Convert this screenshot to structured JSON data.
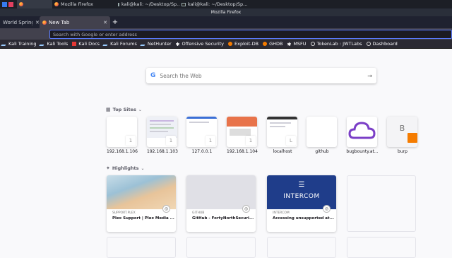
{
  "taskbar": {
    "items": [
      {
        "label": ""
      },
      {
        "label": "Mozilla Firefox"
      },
      {
        "label": "kali@kali: ~/Desktop/Sp..."
      },
      {
        "label": "kali@kali: ~/Desktop/Sp..."
      }
    ]
  },
  "window": {
    "title": "Mozilla Firefox"
  },
  "tabs": [
    {
      "label": "World Spring"
    },
    {
      "label": "New Tab"
    }
  ],
  "url_bar": {
    "placeholder": "Search with Google or enter address"
  },
  "bookmarks": [
    {
      "label": "Kali Training",
      "icon": "kali-icon"
    },
    {
      "label": "Kali Tools",
      "icon": "kali-icon"
    },
    {
      "label": "Kali Docs",
      "icon": "kali-docs-icon"
    },
    {
      "label": "Kali Forums",
      "icon": "kali-icon"
    },
    {
      "label": "NetHunter",
      "icon": "kali-icon"
    },
    {
      "label": "Offensive Security",
      "icon": "offsec-icon"
    },
    {
      "label": "Exploit-DB",
      "icon": "exploitdb-icon"
    },
    {
      "label": "GHDB",
      "icon": "exploitdb-icon"
    },
    {
      "label": "MSFU",
      "icon": "offsec-icon"
    },
    {
      "label": "TokenLab : JWTLabs",
      "icon": "globe-icon"
    },
    {
      "label": "Dashboard",
      "icon": "globe-icon"
    }
  ],
  "search": {
    "placeholder": "Search the Web"
  },
  "top_sites": {
    "title": "Top Sites",
    "items": [
      {
        "label": "192.168.1.106",
        "badge": "1"
      },
      {
        "label": "192.168.1.103",
        "badge": "1"
      },
      {
        "label": "127.0.0.1",
        "badge": "1"
      },
      {
        "label": "192.168.1.104",
        "badge": "1"
      },
      {
        "label": "localhost",
        "badge": "L"
      },
      {
        "label": "github",
        "badge": ""
      },
      {
        "label": "bugbounty.at...",
        "badge": ""
      },
      {
        "label": "burp",
        "badge": "B"
      }
    ]
  },
  "highlights": {
    "title": "Highlights",
    "cards": [
      {
        "source": "SUPPORT.PLEX",
        "title": "Plex Support | Plex Media ..."
      },
      {
        "source": "GITHUB",
        "title": "GitHub - FortyNorthSecuri..."
      },
      {
        "source": "INTERCOM",
        "title": "Accessing unsupported at...",
        "brand": "INTERCOM"
      }
    ]
  },
  "colors": {
    "accent": "#5b7cff",
    "intercom": "#1f3d8a",
    "cloud": "#7b3fc7"
  }
}
